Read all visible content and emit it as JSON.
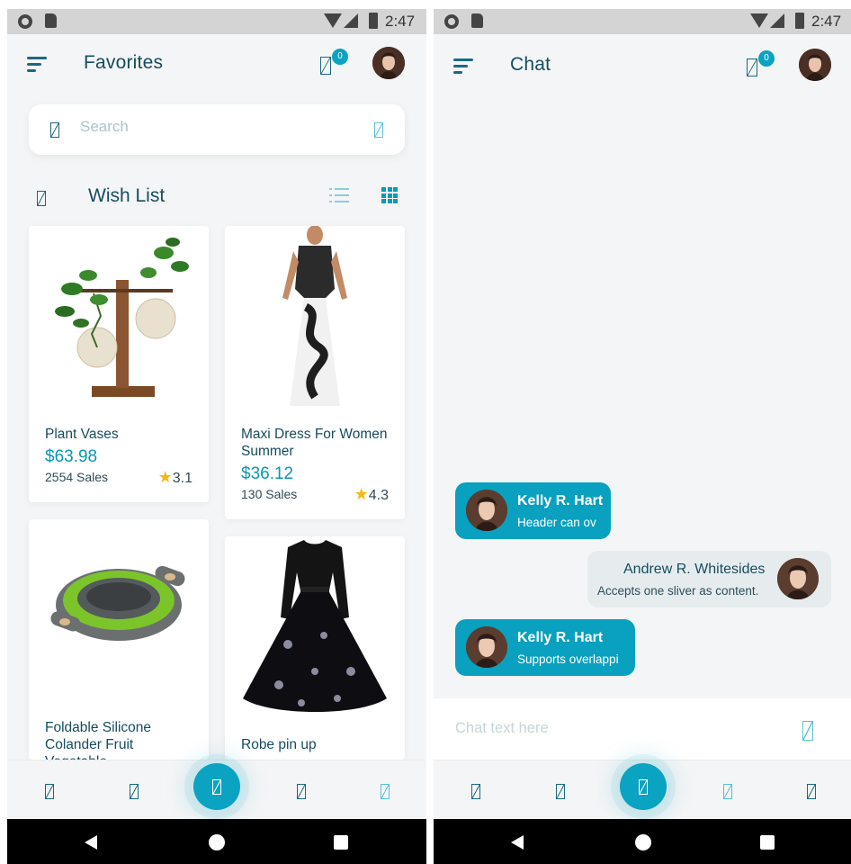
{
  "status_bar": {
    "time": "2:47"
  },
  "favorites_screen": {
    "title": "Favorites",
    "cart_count": "0",
    "search": {
      "placeholder": "Search"
    },
    "section_title": "Wish List",
    "products": [
      {
        "name": "Plant Vases",
        "price": "$63.98",
        "sales": "2554 Sales",
        "rating": "3.1"
      },
      {
        "name": "Maxi Dress For Women Summer",
        "price": "$36.12",
        "sales": "130 Sales",
        "rating": "4.3"
      },
      {
        "name": "Foldable Silicone Colander Fruit Vegetable",
        "price": "",
        "sales": "",
        "rating": ""
      },
      {
        "name": "Robe pin up",
        "price": "",
        "sales": "",
        "rating": ""
      }
    ]
  },
  "chat_screen": {
    "title": "Chat",
    "cart_count": "0",
    "messages": [
      {
        "author": "Kelly R. Hart",
        "text": "Header can ov",
        "direction": "incoming"
      },
      {
        "author": "Andrew R. Whitesides",
        "text": "Accepts one sliver as content.",
        "direction": "outgoing"
      },
      {
        "author": "Kelly R. Hart",
        "text": "Supports overlappi",
        "direction": "incoming"
      }
    ],
    "input_placeholder": "Chat text here"
  },
  "colors": {
    "accent": "#0aa3c2",
    "title_text": "#174c5e",
    "star": "#f6b813"
  }
}
